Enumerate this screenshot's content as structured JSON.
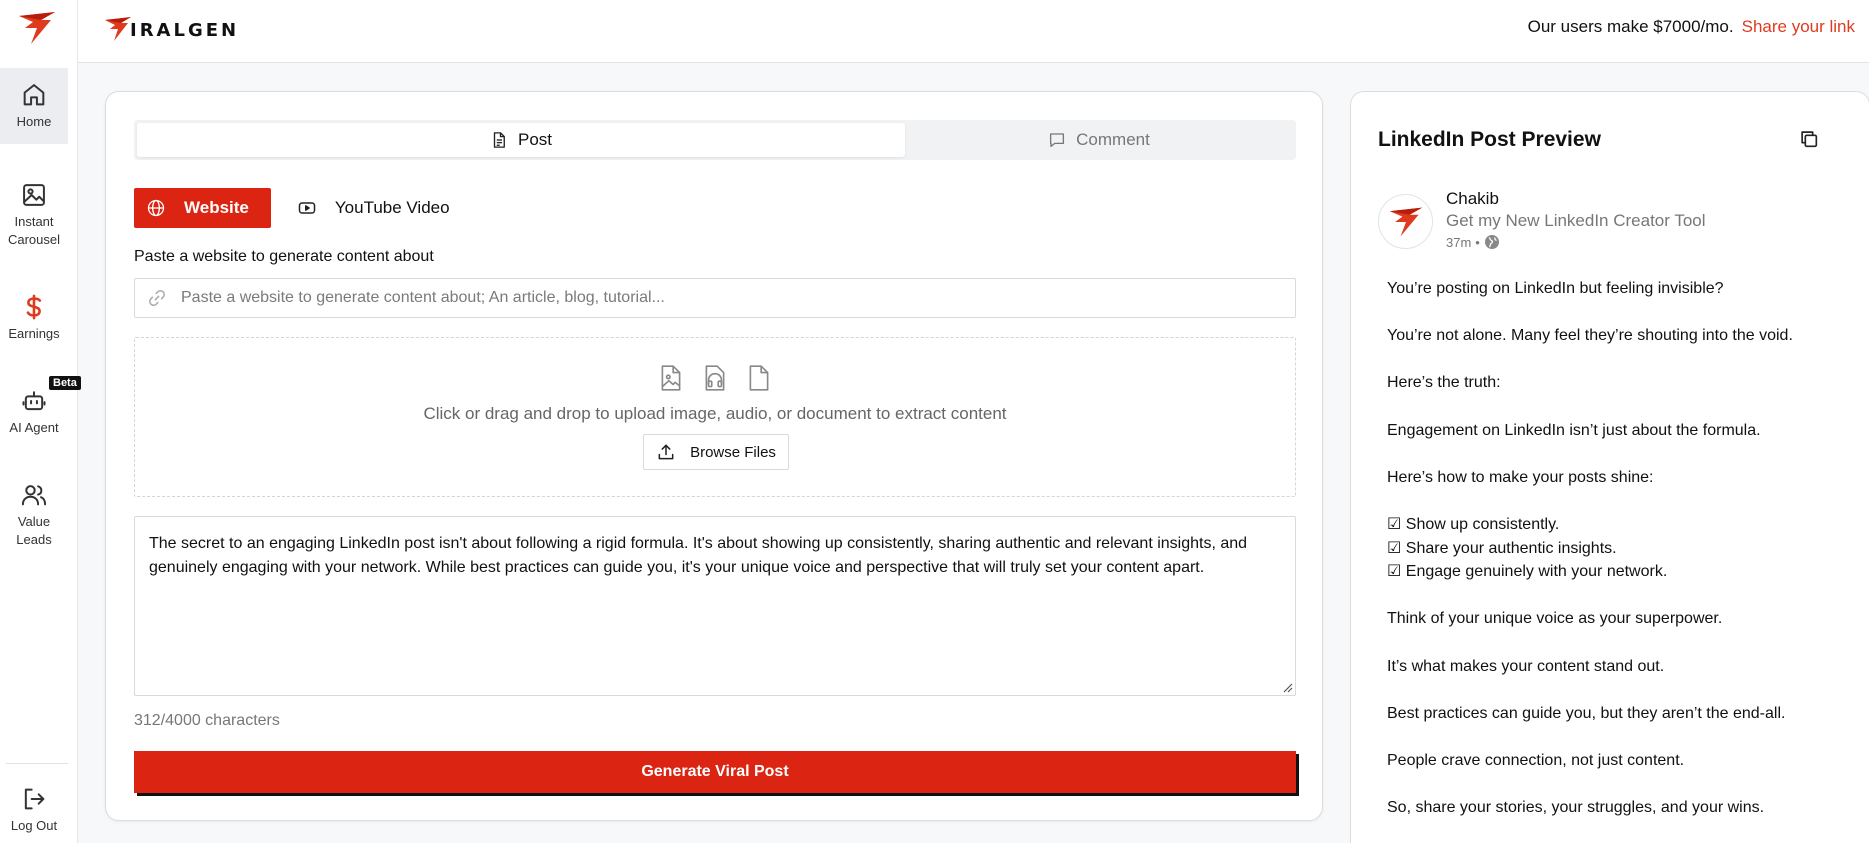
{
  "sidebar": {
    "items": [
      {
        "label": "Home",
        "icon": "home-icon",
        "active": true
      },
      {
        "label": "Instant Carousel",
        "icon": "image-icon",
        "active": false
      },
      {
        "label": "Earnings",
        "icon": "dollar-icon",
        "active": false
      },
      {
        "label": "AI Agent",
        "icon": "robot-icon",
        "active": false
      },
      {
        "label": "Value Leads",
        "icon": "users-icon",
        "active": false
      }
    ],
    "beta_badge": "Beta",
    "logout_label": "Log Out"
  },
  "topbar": {
    "brand": "IRALGEN",
    "promo_text": "Our users make $7000/mo.",
    "share_link": "Share your link"
  },
  "tabs": [
    {
      "label": "Post",
      "active": true
    },
    {
      "label": "Comment",
      "active": false
    }
  ],
  "source_types": [
    {
      "label": "Website",
      "active": true
    },
    {
      "label": "YouTube Video",
      "active": false
    }
  ],
  "website_field": {
    "label": "Paste a website to generate content about",
    "placeholder": "Paste a website to generate content about; An article, blog, tutorial...",
    "value": ""
  },
  "upload": {
    "text": "Click or drag and drop to upload image, audio, or document to extract content",
    "browse_label": "Browse Files"
  },
  "content": {
    "text": "The secret to an engaging LinkedIn post isn't about following a rigid formula. It's about showing up consistently, sharing authentic and relevant insights, and genuinely engaging with your network. While best practices can guide you, it's your unique voice and perspective that will truly set your content apart.",
    "char_count": "312/4000 characters"
  },
  "generate_label": "Generate Viral Post",
  "preview": {
    "title": "LinkedIn Post Preview",
    "author_name": "Chakib",
    "author_headline": "Get my New LinkedIn Creator Tool",
    "time": "37m",
    "separator": "•",
    "lines": [
      "You’re posting on LinkedIn but feeling invisible?",
      "",
      "You’re not alone. Many feel they’re shouting into the void.",
      "",
      "Here’s the truth:",
      "",
      "Engagement on LinkedIn isn’t just about the formula.",
      "",
      "Here’s how to make your posts shine:",
      "",
      "☑ Show up consistently.",
      "☑ Share your authentic insights.",
      "☑ Engage genuinely with your network.",
      "",
      "Think of your unique voice as your superpower.",
      "",
      "It’s what makes your content stand out.",
      "",
      "Best practices can guide you, but they aren’t the end-all.",
      "",
      "People crave connection, not just content.",
      "",
      "So, share your stories, your struggles, and your wins."
    ]
  },
  "colors": {
    "accent": "#dc2412",
    "link": "#e03a1e"
  }
}
